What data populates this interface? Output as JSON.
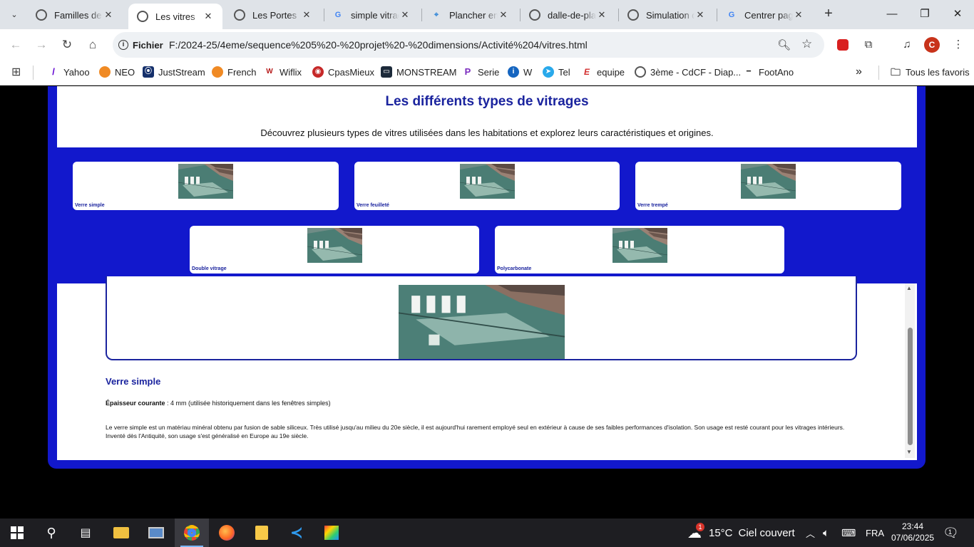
{
  "browser": {
    "tabs": [
      {
        "title": "Familles de matériaux",
        "active": false
      },
      {
        "title": "Les vitres",
        "active": true
      },
      {
        "title": "Les Portes",
        "active": false
      },
      {
        "title": "simple vitrage",
        "active": false
      },
      {
        "title": "Plancher en verre",
        "active": false
      },
      {
        "title": "dalle-de-plancher",
        "active": false
      },
      {
        "title": "Simulation de",
        "active": false
      },
      {
        "title": "Centrer page",
        "active": false
      }
    ],
    "address": {
      "security_label": "Fichier",
      "url": "F:/2024-25/4eme/sequence%205%20-%20projet%20-%20dimensions/Activité%204/vitres.html"
    },
    "profile_initial": "C",
    "bookmarks": [
      "Yahoo",
      "NEO",
      "JustStream",
      "French",
      "Wiflix",
      "CpasMieux",
      "MONSTREAM",
      "Serie",
      "W",
      "Tel",
      "equipe",
      "3ème - CdCF - Diap...",
      "FootAno"
    ],
    "all_bookmarks_label": "Tous les favoris"
  },
  "page": {
    "title": "Les différents types de vitrages",
    "subtitle": "Découvrez plusieurs types de vitres utilisées dans les habitations et explorez leurs caractéristiques et origines.",
    "cards": [
      {
        "label": "Verre simple"
      },
      {
        "label": "Verre feuilleté"
      },
      {
        "label": "Verre trempé"
      },
      {
        "label": "Double vitrage"
      },
      {
        "label": "Polycarbonate"
      }
    ],
    "detail": {
      "heading": "Verre simple",
      "thickness_label": "Épaisseur courante",
      "thickness_value": " : 4 mm (utilisée historiquement dans les fenêtres simples)",
      "description": "Le verre simple est un matériau minéral obtenu par fusion de sable siliceux. Très utilisé jusqu'au milieu du 20e siècle, il est aujourd'hui rarement employé seul en extérieur à cause de ses faibles performances d'isolation. Son usage est resté courant pour les vitrages intérieurs. Inventé dès l'Antiquité, son usage s'est généralisé en Europe au 19e siècle."
    }
  },
  "taskbar": {
    "weather": {
      "badge": "1",
      "temp": "15°C",
      "condition": "Ciel couvert"
    },
    "language": "FRA",
    "time": "23:44",
    "date": "07/06/2025",
    "notification_badge": "1"
  },
  "colors": {
    "page_frame": "#1218cc",
    "heading": "#1a239e",
    "tab_strip": "#dfe3e8"
  }
}
